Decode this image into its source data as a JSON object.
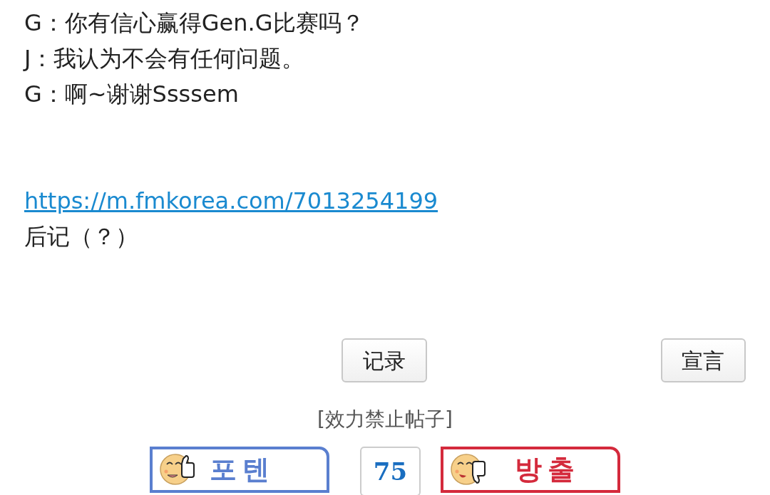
{
  "lines": [
    "G：你有信心赢得Gen.G比赛吗？",
    "J：我认为不会有任何问题。",
    "G：啊~谢谢Ssssem"
  ],
  "link": "https://m.fmkorea.com/7013254199",
  "afterword": "后记（？）",
  "buttons": [
    "记录",
    "宣言"
  ],
  "notice": "[效力禁止帖子]",
  "vote": {
    "up": "포텐",
    "count": "75",
    "down": "방출"
  }
}
